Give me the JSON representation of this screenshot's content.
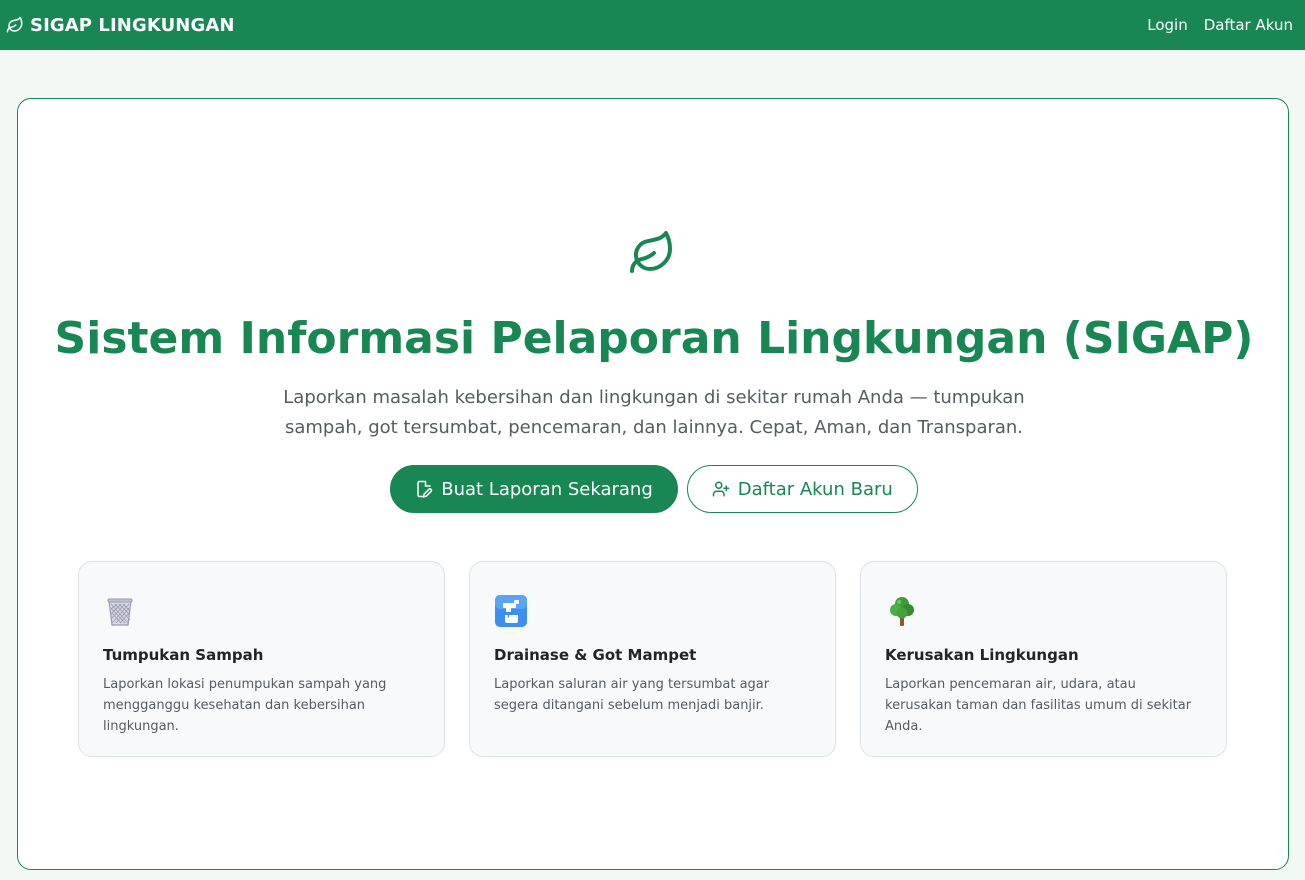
{
  "navbar": {
    "brand": "SIGAP LINGKUNGAN",
    "brand_icon": "leaf-icon",
    "links": [
      {
        "label": "Login"
      },
      {
        "label": "Daftar Akun"
      }
    ]
  },
  "hero": {
    "icon": "leaf-icon",
    "title": "Sistem Informasi Pelaporan Lingkungan (SIGAP)",
    "subtitle": "Laporkan masalah kebersihan dan lingkungan di sekitar rumah Anda — tumpukan sampah, got tersumbat, pencemaran, dan lainnya. Cepat, Aman, dan Transparan.",
    "primary_button": {
      "label": "Buat Laporan Sekarang",
      "icon": "file-edit-icon"
    },
    "secondary_button": {
      "label": "Daftar Akun Baru",
      "icon": "person-plus-icon"
    }
  },
  "features": [
    {
      "icon": "wastebasket-icon",
      "title": "Tumpukan Sampah",
      "description": "Laporkan lokasi penumpukan sampah yang mengganggu kesehatan dan kebersihan lingkungan."
    },
    {
      "icon": "faucet-icon",
      "title": "Drainase & Got Mampet",
      "description": "Laporkan saluran air yang tersumbat agar segera ditangani sebelum menjadi banjir."
    },
    {
      "icon": "tree-icon",
      "title": "Kerusakan Lingkungan",
      "description": "Laporkan pencemaran air, udara, atau kerusakan taman dan fasilitas umum di sekitar Anda."
    }
  ],
  "colors": {
    "primary": "#198754",
    "page_background": "#f2f8f4",
    "card_background": "#f8f9fa",
    "muted_text": "#555c62"
  }
}
